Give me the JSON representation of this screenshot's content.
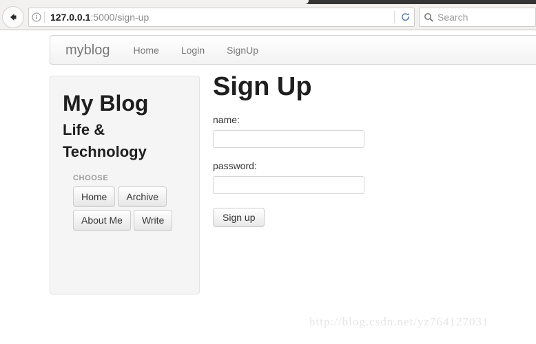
{
  "browser": {
    "back_icon": "back-arrow-icon",
    "identity_icon": "info-circle-icon",
    "url_host": "127.0.0.1",
    "url_rest": ":5000/sign-up",
    "reload_icon": "reload-icon",
    "search": {
      "icon": "search-icon",
      "placeholder": "Search",
      "value": ""
    }
  },
  "navbar": {
    "brand": "myblog",
    "links": [
      {
        "label": "Home"
      },
      {
        "label": "Login"
      },
      {
        "label": "SignUp"
      }
    ]
  },
  "sidebar": {
    "title": "My Blog",
    "subtitle": "Life  &  Technology",
    "choose_label": "CHOOSE",
    "buttons": [
      {
        "label": "Home"
      },
      {
        "label": "Archive"
      },
      {
        "label": "About Me"
      },
      {
        "label": "Write"
      }
    ]
  },
  "main": {
    "title": "Sign Up",
    "name_label": "name:",
    "name_value": "",
    "name_placeholder": "",
    "password_label": "password:",
    "password_value": "",
    "password_placeholder": "",
    "submit_label": "Sign up"
  },
  "watermark": {
    "text": "http://blog.csdn.net/yz764127031"
  },
  "colors": {
    "tab_strip": "#343434",
    "chrome_bg": "#f2f1f0",
    "panel_bg": "#f5f5f5",
    "text_muted": "#777777",
    "text_dark": "#1f1f1f"
  }
}
